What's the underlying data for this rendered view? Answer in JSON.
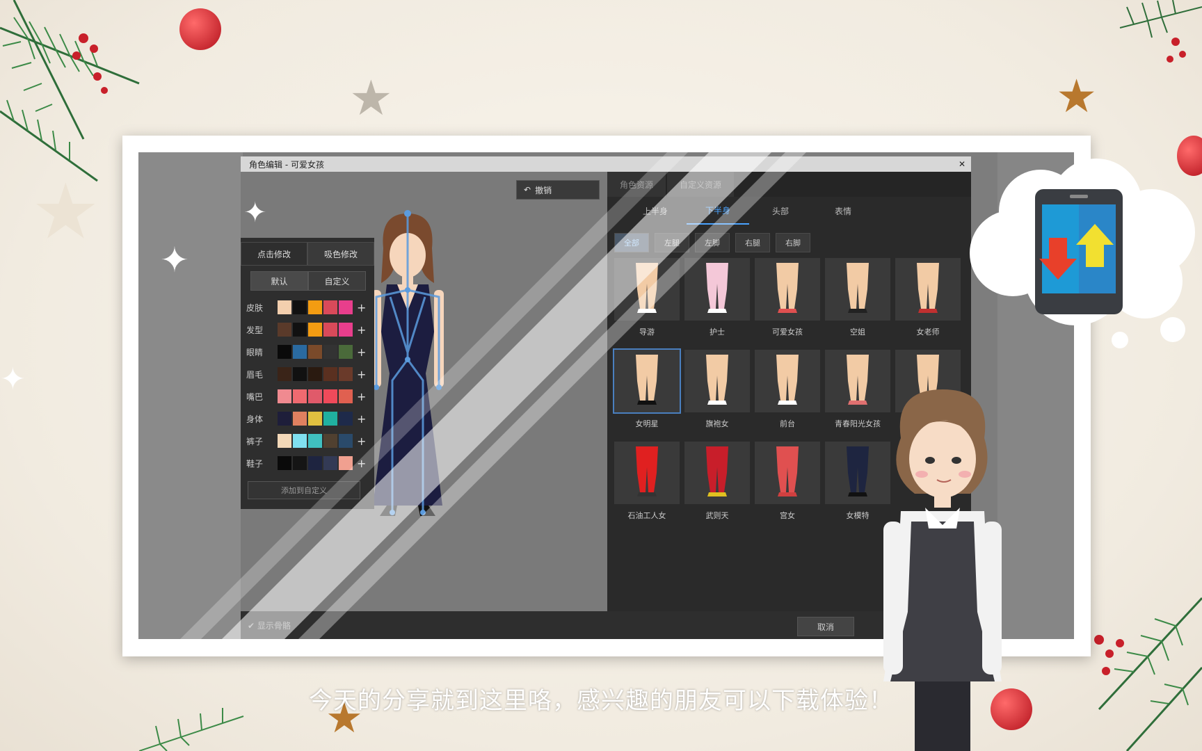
{
  "window": {
    "title": "角色编辑 - 可爱女孩",
    "close": "✕"
  },
  "toolbar": {
    "undo_label": "撤销"
  },
  "color_panel": {
    "tabs": [
      "点击修改",
      "吸色修改"
    ],
    "subtabs": [
      "默认",
      "自定义"
    ],
    "rows": [
      {
        "label": "皮肤",
        "colors": [
          "#f3cfae",
          "#111111",
          "#f39c12",
          "#d94a5a",
          "#e83e8c"
        ]
      },
      {
        "label": "发型",
        "colors": [
          "#5a3a2a",
          "#111111",
          "#f39c12",
          "#d94a5a",
          "#e83e8c"
        ]
      },
      {
        "label": "眼睛",
        "colors": [
          "#0a0a0a",
          "#2a6aa0",
          "#7a4a2a",
          "#333333",
          "#4a6a3a"
        ]
      },
      {
        "label": "眉毛",
        "colors": [
          "#3a2418",
          "#111111",
          "#2a1a10",
          "#5a3020",
          "#6a3a2a"
        ]
      },
      {
        "label": "嘴巴",
        "colors": [
          "#f08a90",
          "#f06a70",
          "#e05a6a",
          "#f04a5a",
          "#e06050"
        ]
      },
      {
        "label": "身体",
        "colors": [
          "#1e1e3a",
          "#e08060",
          "#e0c040",
          "#20b0a0",
          "#1e2a4a"
        ]
      },
      {
        "label": "裤子",
        "colors": [
          "#f3d8b8",
          "#80e0f0",
          "#40c0c0",
          "#504030",
          "#2a4a6a"
        ]
      },
      {
        "label": "鞋子",
        "colors": [
          "#0a0a0a",
          "#151515",
          "#1e2440",
          "#333a55",
          "#f0a090"
        ]
      }
    ],
    "add_label": "添加到自定义"
  },
  "right_panel": {
    "top_tabs": [
      "角色资源",
      "自定义资源"
    ],
    "body_tabs": [
      "上半身",
      "下半身",
      "头部",
      "表情"
    ],
    "active_body_tab": "下半身",
    "part_tabs": [
      "全部",
      "左腿",
      "左脚",
      "右腿",
      "右脚"
    ],
    "items": [
      {
        "label": "导游",
        "color": "#f2cba5",
        "shoe": "#ffffff"
      },
      {
        "label": "护士",
        "color": "#f4c8d8",
        "shoe": "#ffffff"
      },
      {
        "label": "可爱女孩",
        "color": "#f2cba5",
        "shoe": "#e05050"
      },
      {
        "label": "空姐",
        "color": "#f2cba5",
        "shoe": "#222222"
      },
      {
        "label": "女老师",
        "color": "#f2cba5",
        "shoe": "#c03030"
      },
      {
        "label": "女明星",
        "color": "#f2cba5",
        "shoe": "#111111"
      },
      {
        "label": "旗袍女",
        "color": "#f2cba5",
        "shoe": "#ffffff"
      },
      {
        "label": "前台",
        "color": "#f2cba5",
        "shoe": "#ffffff"
      },
      {
        "label": "青春阳光女孩",
        "color": "#f2cba5",
        "shoe": "#e07070"
      },
      {
        "label": "",
        "color": "#f2cba5",
        "shoe": "#c03030"
      },
      {
        "label": "石油工人女",
        "color": "#e02020",
        "shoe": "#333333"
      },
      {
        "label": "武则天",
        "color": "#c81e2a",
        "shoe": "#e0c020"
      },
      {
        "label": "宫女",
        "color": "#e05050",
        "shoe": "#d04040"
      },
      {
        "label": "女模特",
        "color": "#1e2540",
        "shoe": "#111111"
      }
    ]
  },
  "statusbar": {
    "checkbox_label": "显示骨骼",
    "cancel_label": "取消"
  },
  "subtitle": "今天的分享就到这里咯，感兴趣的朋友可以下载体验！"
}
